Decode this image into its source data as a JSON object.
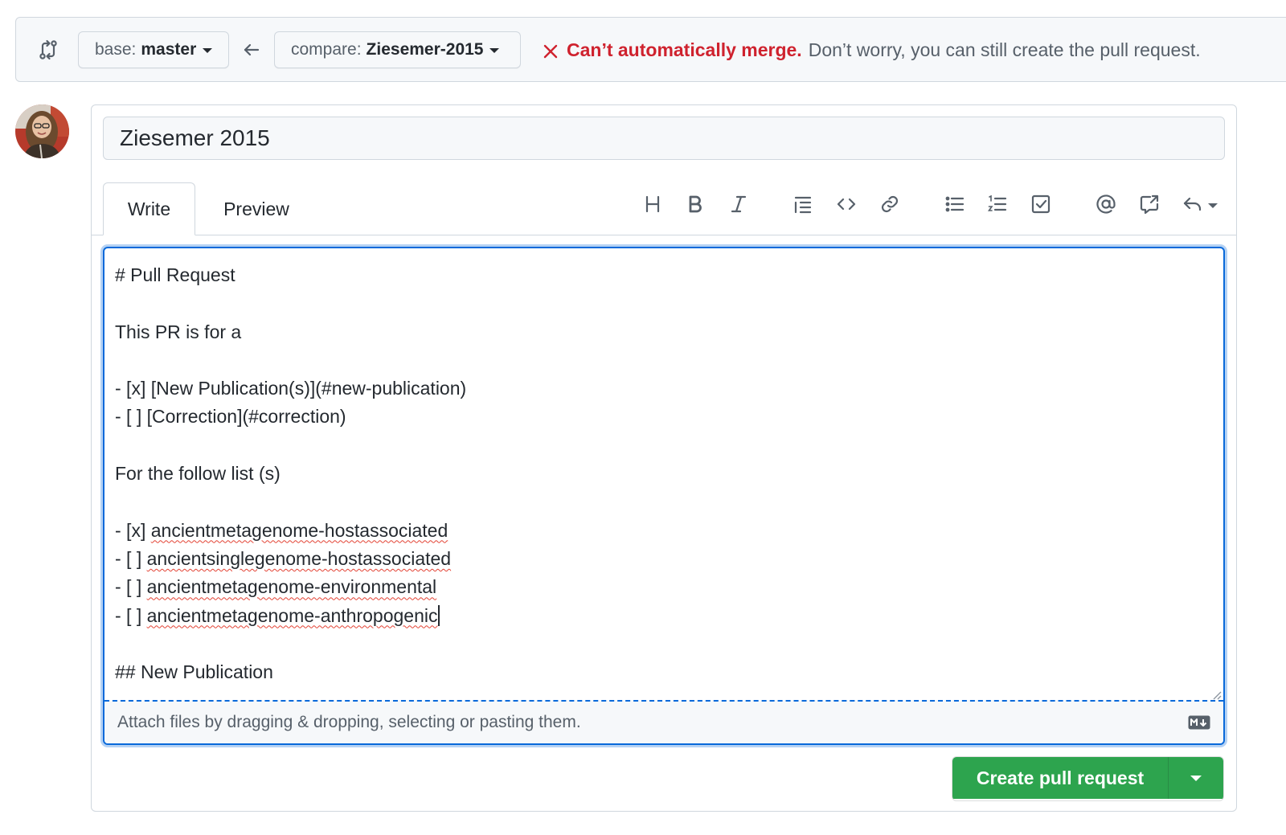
{
  "compare_bar": {
    "base_prefix": "base:",
    "base_branch": "master",
    "compare_prefix": "compare:",
    "compare_branch": "Ziesemer-2015",
    "merge_error": "Can’t automatically merge.",
    "merge_hint": "Don’t worry, you can still create the pull request."
  },
  "form": {
    "title_value": "Ziesemer 2015",
    "tabs": [
      {
        "label": "Write",
        "active": true
      },
      {
        "label": "Preview",
        "active": false
      }
    ],
    "toolbar": [
      "heading-icon",
      "bold-icon",
      "italic-icon",
      "quote-icon",
      "code-icon",
      "link-icon",
      "unordered-list-icon",
      "ordered-list-icon",
      "task-list-icon",
      "mention-icon",
      "cross-reference-icon",
      "reply-icon"
    ],
    "body_lines": [
      {
        "text": "# Pull Request"
      },
      {
        "text": ""
      },
      {
        "text": "This PR is for a"
      },
      {
        "text": ""
      },
      {
        "text": "- [x] [New Publication(s)](#new-publication)"
      },
      {
        "text": "- [ ] [Correction](#correction)"
      },
      {
        "text": ""
      },
      {
        "text": "For the follow list (s)"
      },
      {
        "text": ""
      },
      {
        "prefix": "- [x] ",
        "text": "ancientmetagenome-hostassociated",
        "misspelled": true
      },
      {
        "prefix": "- [ ] ",
        "text": "ancientsinglegenome-hostassociated",
        "misspelled": true
      },
      {
        "prefix": "- [ ] ",
        "text": "ancientmetagenome-environmental",
        "misspelled": true
      },
      {
        "prefix": "- [ ] ",
        "text": "ancientmetagenome-anthropogenic",
        "misspelled": true,
        "cursor": true
      },
      {
        "text": ""
      },
      {
        "text": "## New Publication"
      }
    ],
    "attach_hint": "Attach files by dragging & dropping, selecting or pasting them.",
    "submit_label": "Create pull request"
  },
  "colors": {
    "error": "#cf222e",
    "primary_button": "#2da44e",
    "focus_border": "#0969da"
  }
}
